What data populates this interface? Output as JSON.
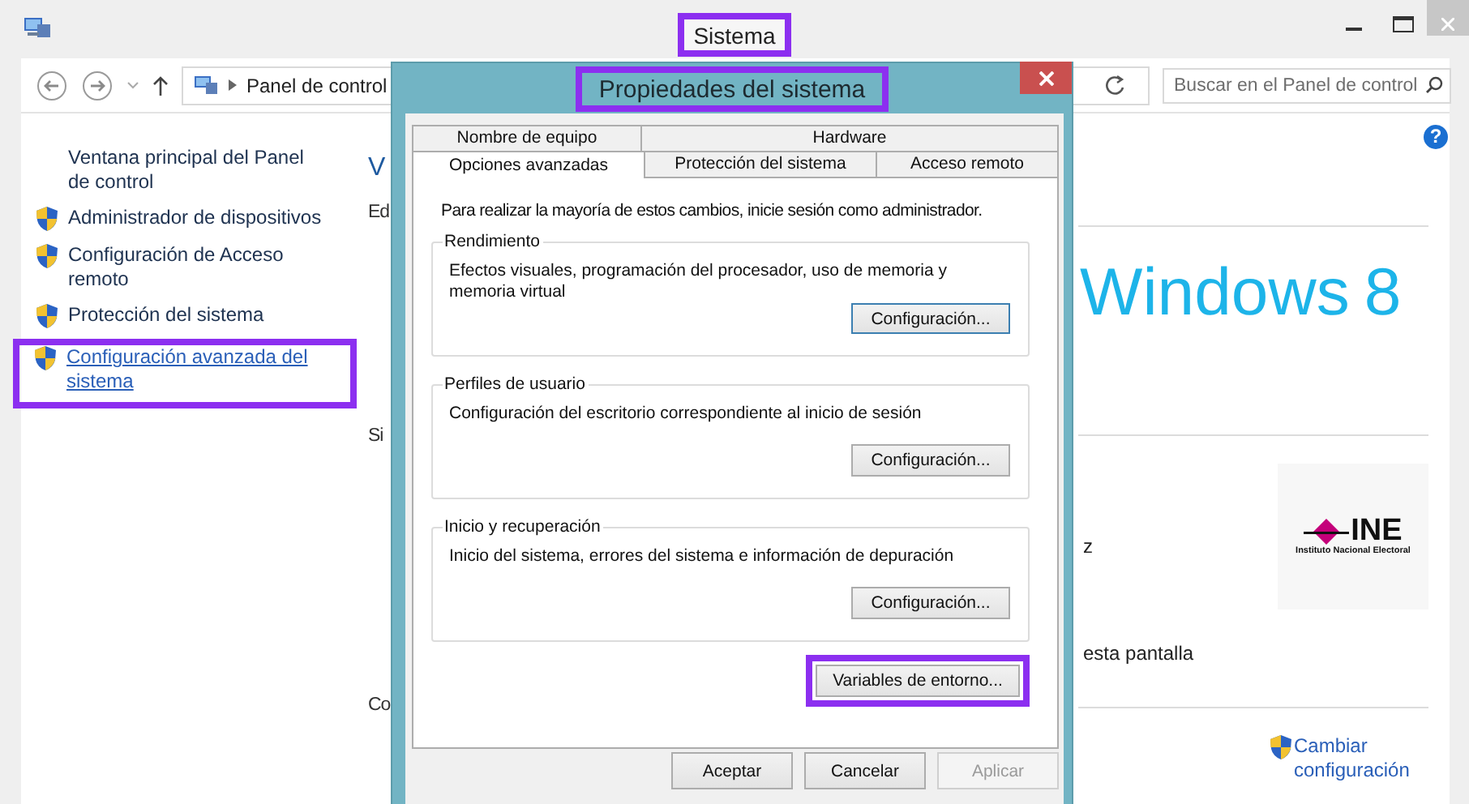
{
  "window": {
    "title": "Sistema",
    "title_highlighted": true
  },
  "nav": {
    "breadcrumb": "Panel de control",
    "search": {
      "placeholder": "Buscar en el Panel de control"
    }
  },
  "sidebar": {
    "items": [
      {
        "label": "Ventana principal del Panel de control",
        "kind": "link",
        "selected": false,
        "highlighted": false
      },
      {
        "label": "Administrador de dispositivos",
        "kind": "shield-link",
        "selected": false,
        "highlighted": false
      },
      {
        "label": "Configuración de Acceso remoto",
        "kind": "shield-link",
        "selected": false,
        "highlighted": false
      },
      {
        "label": "Protección del sistema",
        "kind": "shield-link",
        "selected": false,
        "highlighted": false
      },
      {
        "label": "Configuración avanzada del sistema",
        "kind": "shield-link",
        "selected": true,
        "highlighted": true
      }
    ]
  },
  "content": {
    "help": "?",
    "left_fragments": [
      {
        "text": "V",
        "kind": "heading"
      },
      {
        "text": "Ed",
        "kind": "label"
      },
      {
        "text": "Si",
        "kind": "label"
      },
      {
        "text": "Co",
        "kind": "label"
      }
    ],
    "logo": {
      "name": "Windows",
      "version": "8"
    },
    "right_fragments": [
      "z",
      "esta pantalla"
    ],
    "org_logo": {
      "name": "INE",
      "subtitle": "Instituto Nacional Electoral"
    },
    "change_link": "Cambiar configuración"
  },
  "dialog": {
    "title": "Propiedades del sistema",
    "title_highlighted": true,
    "tab_rows": [
      [
        {
          "label": "Nombre de equipo",
          "selected": false
        },
        {
          "label": "Hardware",
          "selected": false
        }
      ],
      [
        {
          "label": "Opciones avanzadas",
          "selected": true
        },
        {
          "label": "Protección del sistema",
          "selected": false
        },
        {
          "label": "Acceso remoto",
          "selected": false
        }
      ]
    ],
    "notice": "Para realizar la mayoría de estos cambios, inicie sesión como administrador.",
    "groups": [
      {
        "title": "Rendimiento",
        "description": "Efectos visuales, programación del procesador, uso de memoria y memoria virtual",
        "button": "Configuración...",
        "focused": true
      },
      {
        "title": "Perfiles de usuario",
        "description": "Configuración del escritorio correspondiente al inicio de sesión",
        "button": "Configuración...",
        "focused": false
      },
      {
        "title": "Inicio y recuperación",
        "description": "Inicio del sistema, errores del sistema e información de depuración",
        "button": "Configuración...",
        "focused": false
      }
    ],
    "env_button": {
      "label": "Variables de entorno...",
      "highlighted": true
    },
    "buttons": [
      {
        "label": "Aceptar",
        "disabled": false
      },
      {
        "label": "Cancelar",
        "disabled": false
      },
      {
        "label": "Aplicar",
        "disabled": true
      }
    ]
  }
}
